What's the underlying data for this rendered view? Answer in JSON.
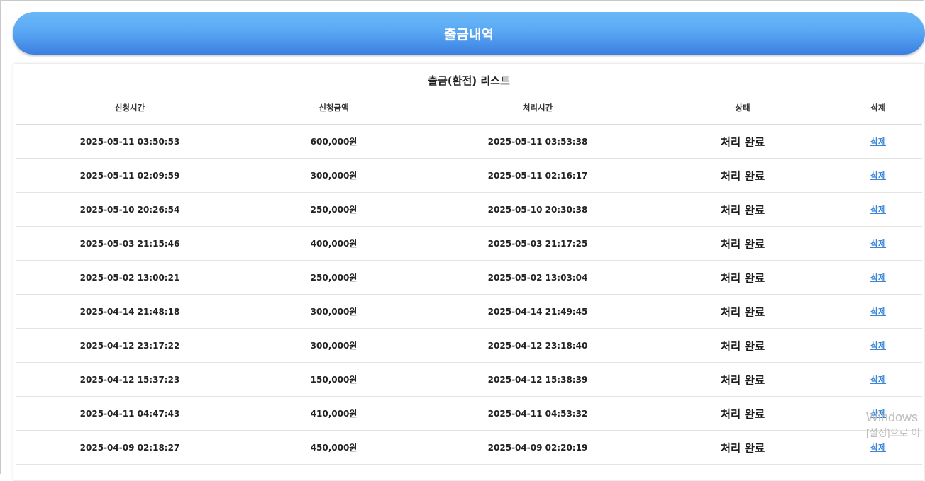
{
  "header": {
    "title": "출금내역"
  },
  "list": {
    "title": "출금(환전) 리스트",
    "columns": [
      "신청시간",
      "신청금액",
      "처리시간",
      "상태",
      "삭제"
    ],
    "rows": [
      {
        "requested_at": "2025-05-11 03:50:53",
        "amount": "600,000원",
        "processed_at": "2025-05-11 03:53:38",
        "status": "처리 완료",
        "delete_label": "삭제"
      },
      {
        "requested_at": "2025-05-11 02:09:59",
        "amount": "300,000원",
        "processed_at": "2025-05-11 02:16:17",
        "status": "처리 완료",
        "delete_label": "삭제"
      },
      {
        "requested_at": "2025-05-10 20:26:54",
        "amount": "250,000원",
        "processed_at": "2025-05-10 20:30:38",
        "status": "처리 완료",
        "delete_label": "삭제"
      },
      {
        "requested_at": "2025-05-03 21:15:46",
        "amount": "400,000원",
        "processed_at": "2025-05-03 21:17:25",
        "status": "처리 완료",
        "delete_label": "삭제"
      },
      {
        "requested_at": "2025-05-02 13:00:21",
        "amount": "250,000원",
        "processed_at": "2025-05-02 13:03:04",
        "status": "처리 완료",
        "delete_label": "삭제"
      },
      {
        "requested_at": "2025-04-14 21:48:18",
        "amount": "300,000원",
        "processed_at": "2025-04-14 21:49:45",
        "status": "처리 완료",
        "delete_label": "삭제"
      },
      {
        "requested_at": "2025-04-12 23:17:22",
        "amount": "300,000원",
        "processed_at": "2025-04-12 23:18:40",
        "status": "처리 완료",
        "delete_label": "삭제"
      },
      {
        "requested_at": "2025-04-12 15:37:23",
        "amount": "150,000원",
        "processed_at": "2025-04-12 15:38:39",
        "status": "처리 완료",
        "delete_label": "삭제"
      },
      {
        "requested_at": "2025-04-11 04:47:43",
        "amount": "410,000원",
        "processed_at": "2025-04-11 04:53:32",
        "status": "처리 완료",
        "delete_label": "삭제"
      },
      {
        "requested_at": "2025-04-09 02:18:27",
        "amount": "450,000원",
        "processed_at": "2025-04-09 02:20:19",
        "status": "처리 완료",
        "delete_label": "삭제"
      }
    ]
  },
  "watermark": {
    "line1": "Windows",
    "line2": "[설정]으로 이"
  },
  "colors": {
    "banner_top": "#6ab8f7",
    "banner_bottom": "#3b7fe0",
    "link": "#3b86d6"
  }
}
